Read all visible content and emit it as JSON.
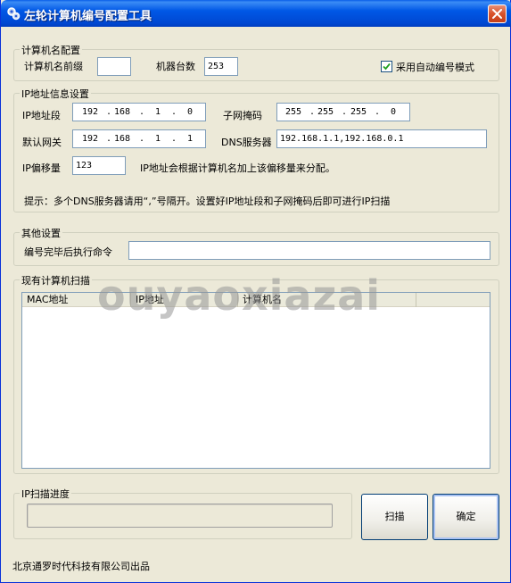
{
  "window": {
    "title": "左轮计算机编号配置工具"
  },
  "computer_name": {
    "group_title": "计算机名配置",
    "prefix_label": "计算机名前缀",
    "prefix_value": "",
    "count_label": "机器台数",
    "count_value": "253",
    "auto_number_label": "采用自动编号模式",
    "auto_number_checked": true
  },
  "ip": {
    "group_title": "IP地址信息设置",
    "segment_label": "IP地址段",
    "segment": [
      "192",
      "168",
      "1",
      "0"
    ],
    "mask_label": "子网掩码",
    "mask": [
      "255",
      "255",
      "255",
      "0"
    ],
    "gateway_label": "默认网关",
    "gateway": [
      "192",
      "168",
      "1",
      "1"
    ],
    "dns_label": "DNS服务器",
    "dns_value": "192.168.1.1,192.168.0.1",
    "offset_label": "IP偏移量",
    "offset_value": "123",
    "offset_note": "IP地址会根据计算机名加上该偏移量来分配。",
    "hint": "提示：多个DNS服务器请用“,”号隔开。设置好IP地址段和子网掩码后即可进行IP扫描"
  },
  "other": {
    "group_title": "其他设置",
    "command_label": "编号完毕后执行命令",
    "command_value": ""
  },
  "scan": {
    "group_title": "现有计算机扫描",
    "columns": [
      "MAC地址",
      "IP地址",
      "计算机名"
    ]
  },
  "progress": {
    "group_title": "IP扫描进度",
    "value": 0
  },
  "buttons": {
    "scan_label": "扫描",
    "ok_label": "确定"
  },
  "footer": {
    "credit": "北京通罗时代科技有限公司出品"
  },
  "watermark": {
    "text": "ouyaoxiazai"
  }
}
